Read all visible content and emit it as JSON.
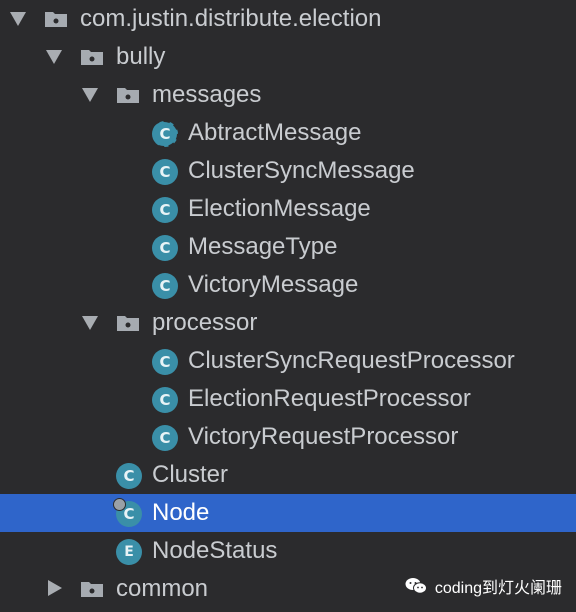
{
  "tree": {
    "root": {
      "label": "com.justin.distribute.election"
    },
    "bully": {
      "label": "bully"
    },
    "messages": {
      "label": "messages"
    },
    "messages_items": [
      {
        "label": "AbtractMessage",
        "icon": "abstract-class-icon",
        "letter": "C"
      },
      {
        "label": "ClusterSyncMessage",
        "icon": "class-icon",
        "letter": "C"
      },
      {
        "label": "ElectionMessage",
        "icon": "class-icon",
        "letter": "C"
      },
      {
        "label": "MessageType",
        "icon": "class-icon",
        "letter": "C"
      },
      {
        "label": "VictoryMessage",
        "icon": "class-icon",
        "letter": "C"
      }
    ],
    "processor": {
      "label": "processor"
    },
    "processor_items": [
      {
        "label": "ClusterSyncRequestProcessor",
        "icon": "class-icon",
        "letter": "C"
      },
      {
        "label": "ElectionRequestProcessor",
        "icon": "class-icon",
        "letter": "C"
      },
      {
        "label": "VictoryRequestProcessor",
        "icon": "class-icon",
        "letter": "C"
      }
    ],
    "cluster": {
      "label": "Cluster",
      "letter": "C"
    },
    "node": {
      "label": "Node",
      "letter": "C",
      "selected": true
    },
    "nodestatus": {
      "label": "NodeStatus",
      "letter": "E"
    },
    "common": {
      "label": "common"
    }
  },
  "watermark": {
    "text": "coding到灯火阑珊"
  },
  "colors": {
    "background": "#2b2b2d",
    "selection": "#2f65ca",
    "class_icon": "#3a8fa8",
    "text": "#c9ccd0"
  }
}
